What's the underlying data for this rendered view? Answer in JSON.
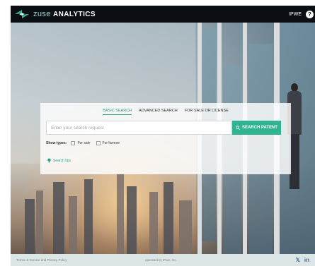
{
  "header": {
    "brand_prefix": "zuse",
    "brand_suffix": "ANALYTICS",
    "right_link": "IPWE"
  },
  "search": {
    "tabs": [
      {
        "label": "BASIC SEARCH",
        "active": true
      },
      {
        "label": "ADVANCED SEARCH",
        "active": false
      },
      {
        "label": "FOR SALE OR LICENSE",
        "active": false
      }
    ],
    "placeholder": "Enter your search request",
    "button_label": "SEARCH PATENT",
    "show_types_label": "Show types:",
    "options": [
      {
        "label": "For sale",
        "checked": false
      },
      {
        "label": "For license",
        "checked": false
      }
    ],
    "tips_label": "Search tips"
  },
  "footer": {
    "terms": "Terms of Service and Privacy Policy",
    "powered": "operated by IPwe, Inc."
  },
  "colors": {
    "accent": "#2fb390",
    "topbar": "#0b0f13",
    "footer_bg": "#dde6e6"
  }
}
